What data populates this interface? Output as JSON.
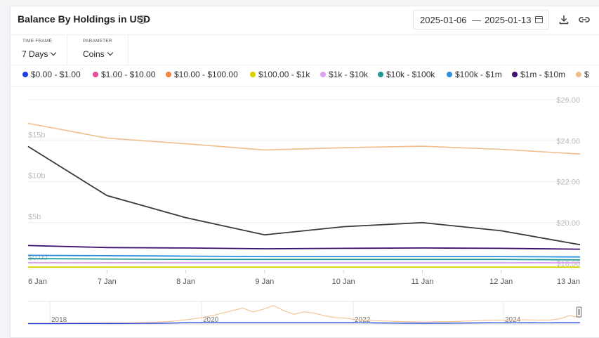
{
  "header": {
    "title": "Balance By Holdings in USD",
    "help_icon": "?",
    "date_start": "2025-01-06",
    "date_sep": "—",
    "date_end": "2025-01-13",
    "icons": [
      "calendar-icon",
      "download-icon",
      "link-icon"
    ]
  },
  "controls": {
    "time_frame_label": "TIME FRAME",
    "time_frame_value": "7 Days",
    "parameter_label": "PARAMETER",
    "parameter_value": "Coins"
  },
  "legend": [
    {
      "label": "$0.00 - $1.00",
      "color": "#1d3fe0"
    },
    {
      "label": "$1.00 - $10.00",
      "color": "#e54a9b"
    },
    {
      "label": "$10.00 - $100.00",
      "color": "#f0863a"
    },
    {
      "label": "$100.00 - $1k",
      "color": "#d9d300"
    },
    {
      "label": "$1k - $10k",
      "color": "#d9a3f0"
    },
    {
      "label": "$10k - $100k",
      "color": "#1e9a96"
    },
    {
      "label": "$100k - $1m",
      "color": "#2a8fe0"
    },
    {
      "label": "$1m - $10m",
      "color": "#3d0f6e"
    },
    {
      "label": "$",
      "color": "#f0bd8c"
    }
  ],
  "chart_data": {
    "type": "line",
    "x": [
      "6 Jan",
      "7 Jan",
      "8 Jan",
      "9 Jan",
      "10 Jan",
      "11 Jan",
      "12 Jan",
      "13 Jan"
    ],
    "left_axis": {
      "ticks": [
        "$0.00",
        "$5b",
        "$10b",
        "$15b"
      ],
      "ylim": [
        0,
        20
      ]
    },
    "right_axis": {
      "ticks": [
        "$18.00",
        "$20.00",
        "$22.00",
        "$24.00",
        "$26.00"
      ],
      "ylim": [
        18,
        26
      ]
    },
    "series": [
      {
        "color": "#f0bd8c",
        "axis": "right",
        "values": [
          24.85,
          24.13,
          23.85,
          23.55,
          23.66,
          23.73,
          23.58,
          23.35
        ]
      },
      {
        "color": "#3a3a3a",
        "axis": "left",
        "values": [
          14.3,
          8.3,
          5.6,
          3.5,
          4.5,
          5.0,
          4.0,
          2.3
        ]
      },
      {
        "color": "#3d0f6e",
        "axis": "left",
        "values": [
          2.2,
          1.95,
          1.9,
          1.8,
          1.85,
          1.9,
          1.85,
          1.75
        ]
      },
      {
        "color": "#2a8fe0",
        "axis": "left",
        "values": [
          1.0,
          0.95,
          0.9,
          0.85,
          0.85,
          0.85,
          0.85,
          0.8
        ]
      },
      {
        "color": "#1e9a96",
        "axis": "left",
        "values": [
          0.6,
          0.55,
          0.5,
          0.5,
          0.5,
          0.5,
          0.5,
          0.45
        ]
      },
      {
        "color": "#d9a3f0",
        "axis": "left",
        "values": [
          0.1,
          0.1,
          0.1,
          0.1,
          0.1,
          0.1,
          0.1,
          0.1
        ]
      },
      {
        "color": "#d9d300",
        "axis": "left",
        "values": [
          -0.45,
          -0.45,
          -0.45,
          -0.45,
          -0.45,
          -0.45,
          -0.45,
          -0.45
        ]
      }
    ],
    "navigator_labels": [
      "2018",
      "2020",
      "2022",
      "2024"
    ]
  }
}
